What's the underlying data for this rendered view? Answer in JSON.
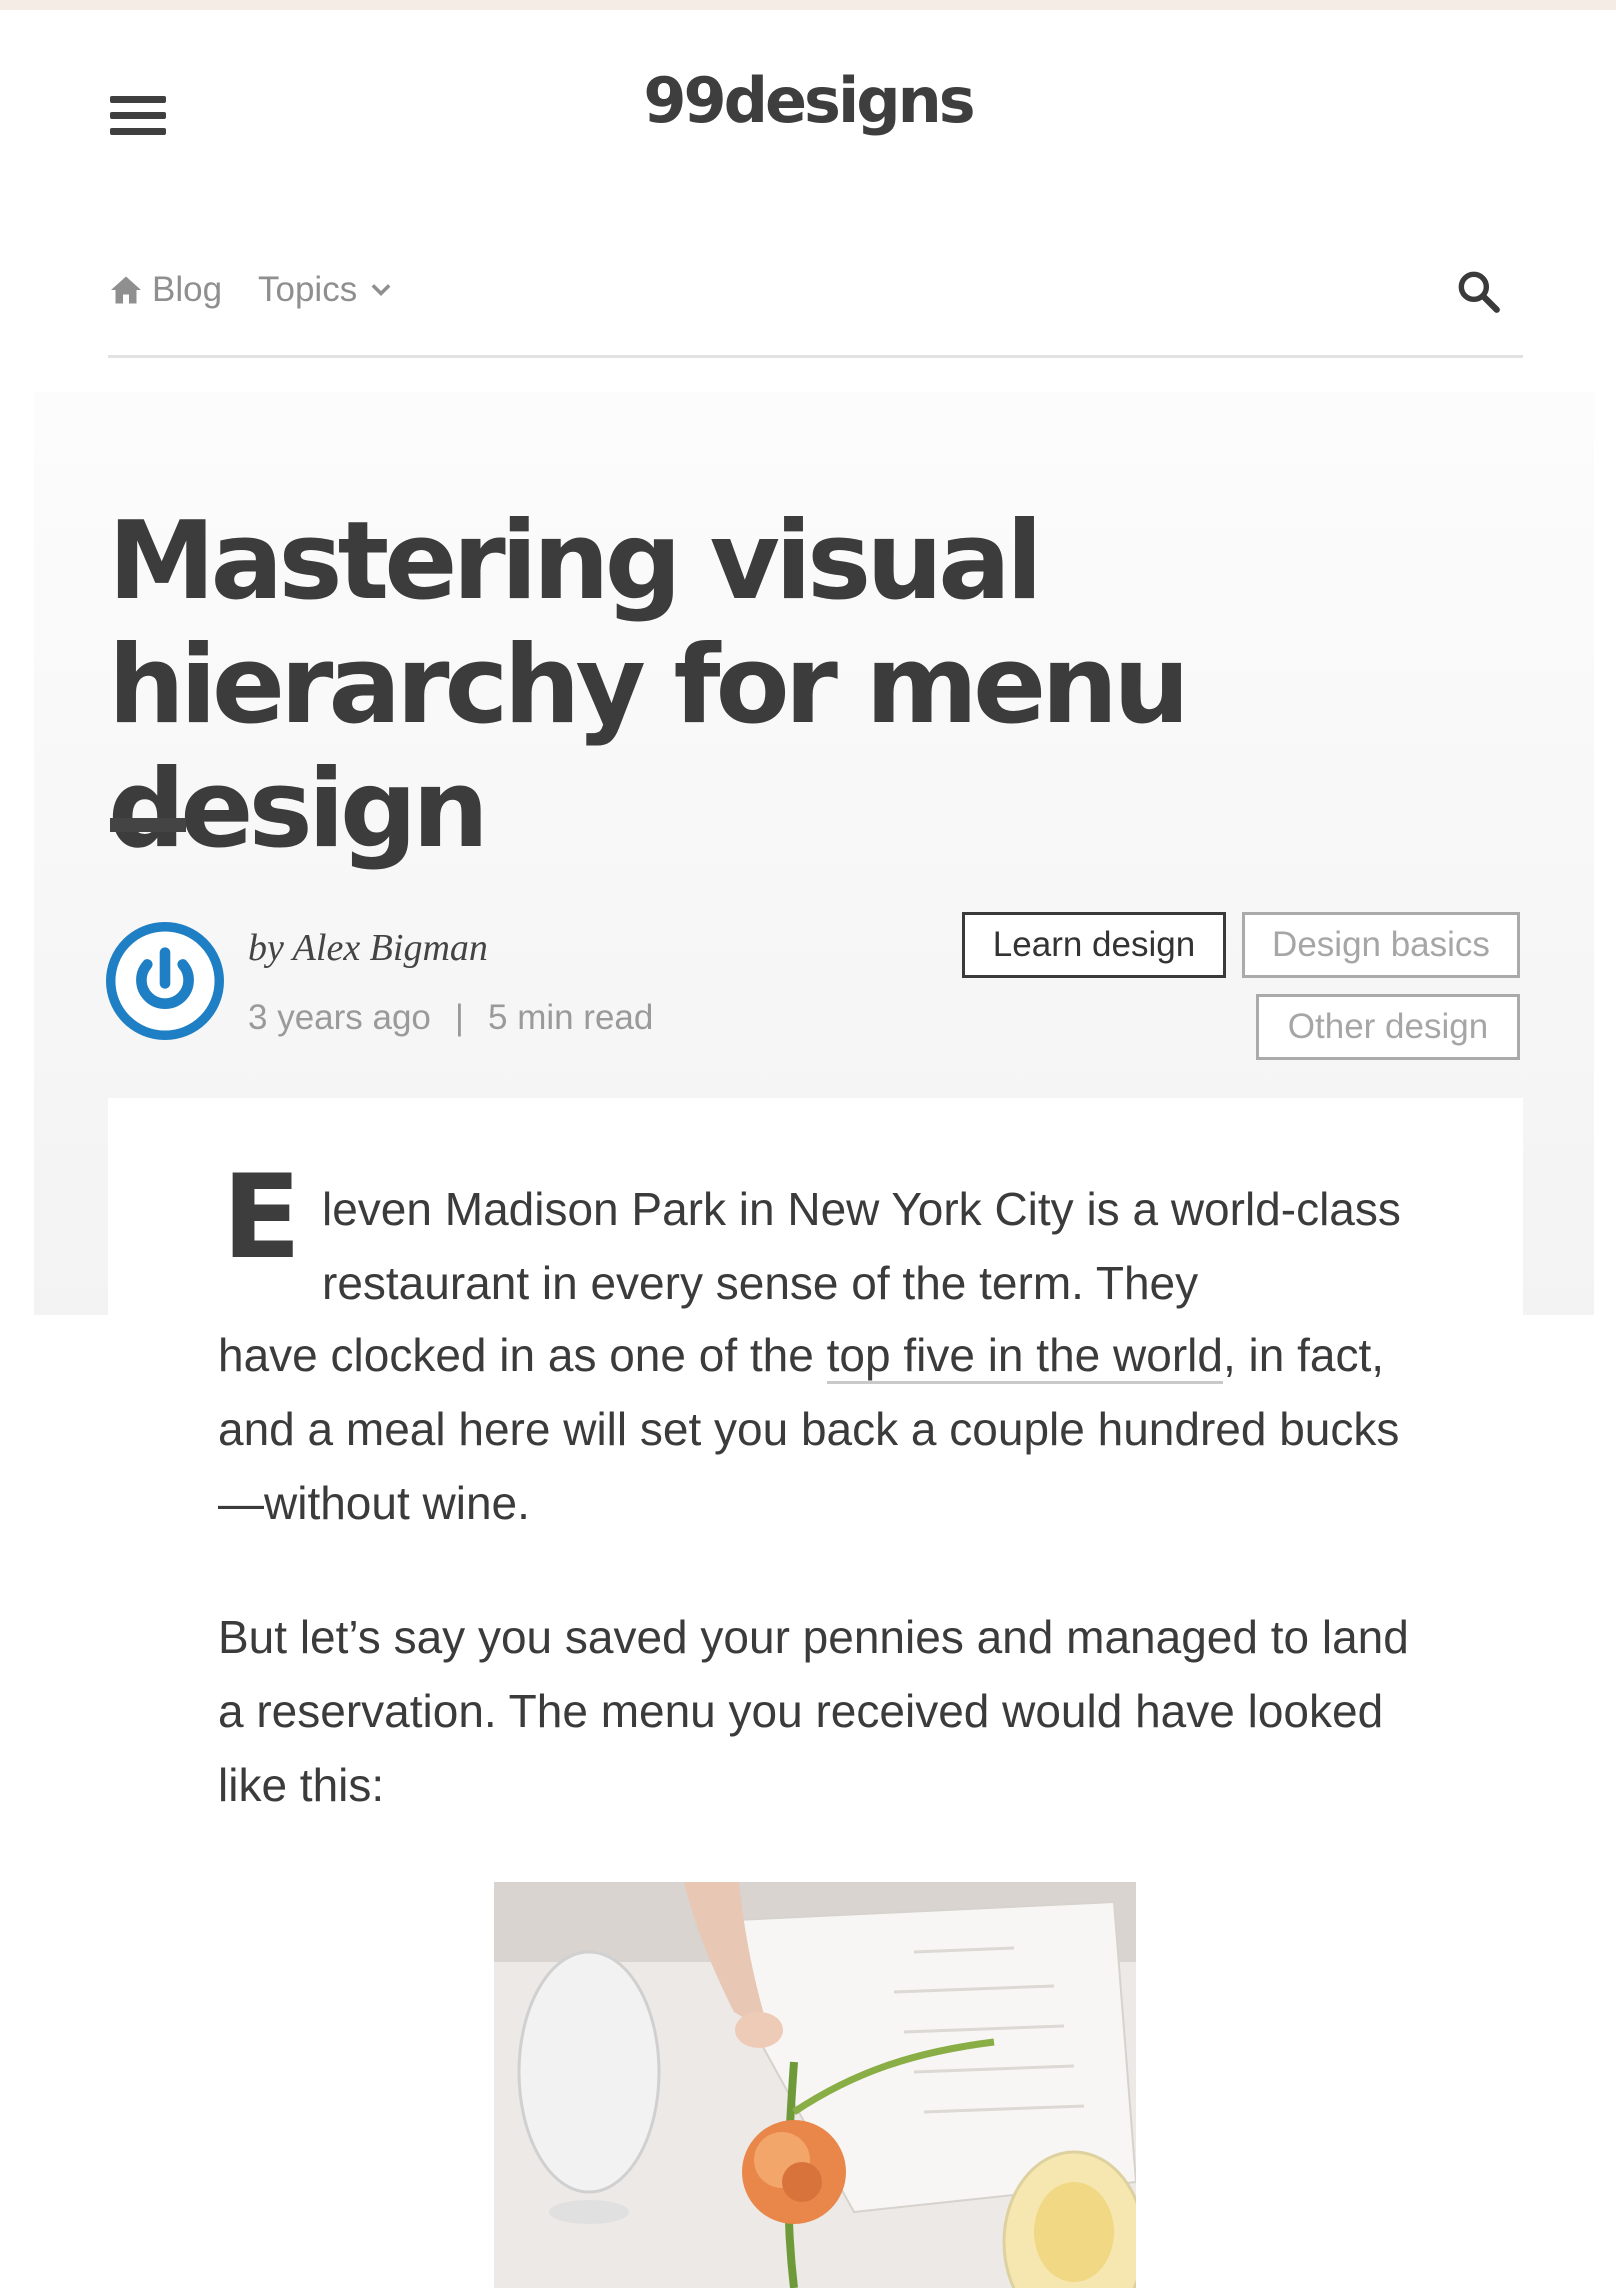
{
  "brand": {
    "logo_text": "99designs"
  },
  "nav": {
    "home_label": "Blog",
    "topics_label": "Topics"
  },
  "article": {
    "title": "Mastering visual hierarchy for menu design",
    "byline": "by Alex Bigman",
    "posted": "3 years ago",
    "separator": "|",
    "read_time": "5 min read",
    "tags": [
      {
        "label": "Learn design"
      },
      {
        "label": "Design basics"
      },
      {
        "label": "Other design"
      }
    ],
    "paragraph1": {
      "dropcap": "E",
      "lead_lines": "leven Madison Park in New York City is a world-class restaurant in every sense of the term. They",
      "before_link": "have clocked in as one of the ",
      "link_text": "top five in the world",
      "after_link": ", in fact, and a meal here will set you back a couple hundred bucks—without wine."
    },
    "paragraph2": "But let’s say you saved your pennies and managed to land a reservation. The menu you received would have looked like this:"
  },
  "colors": {
    "accent_blue": "#1f7fc4",
    "text": "#3b3b3b",
    "muted": "#9a9a9a"
  }
}
